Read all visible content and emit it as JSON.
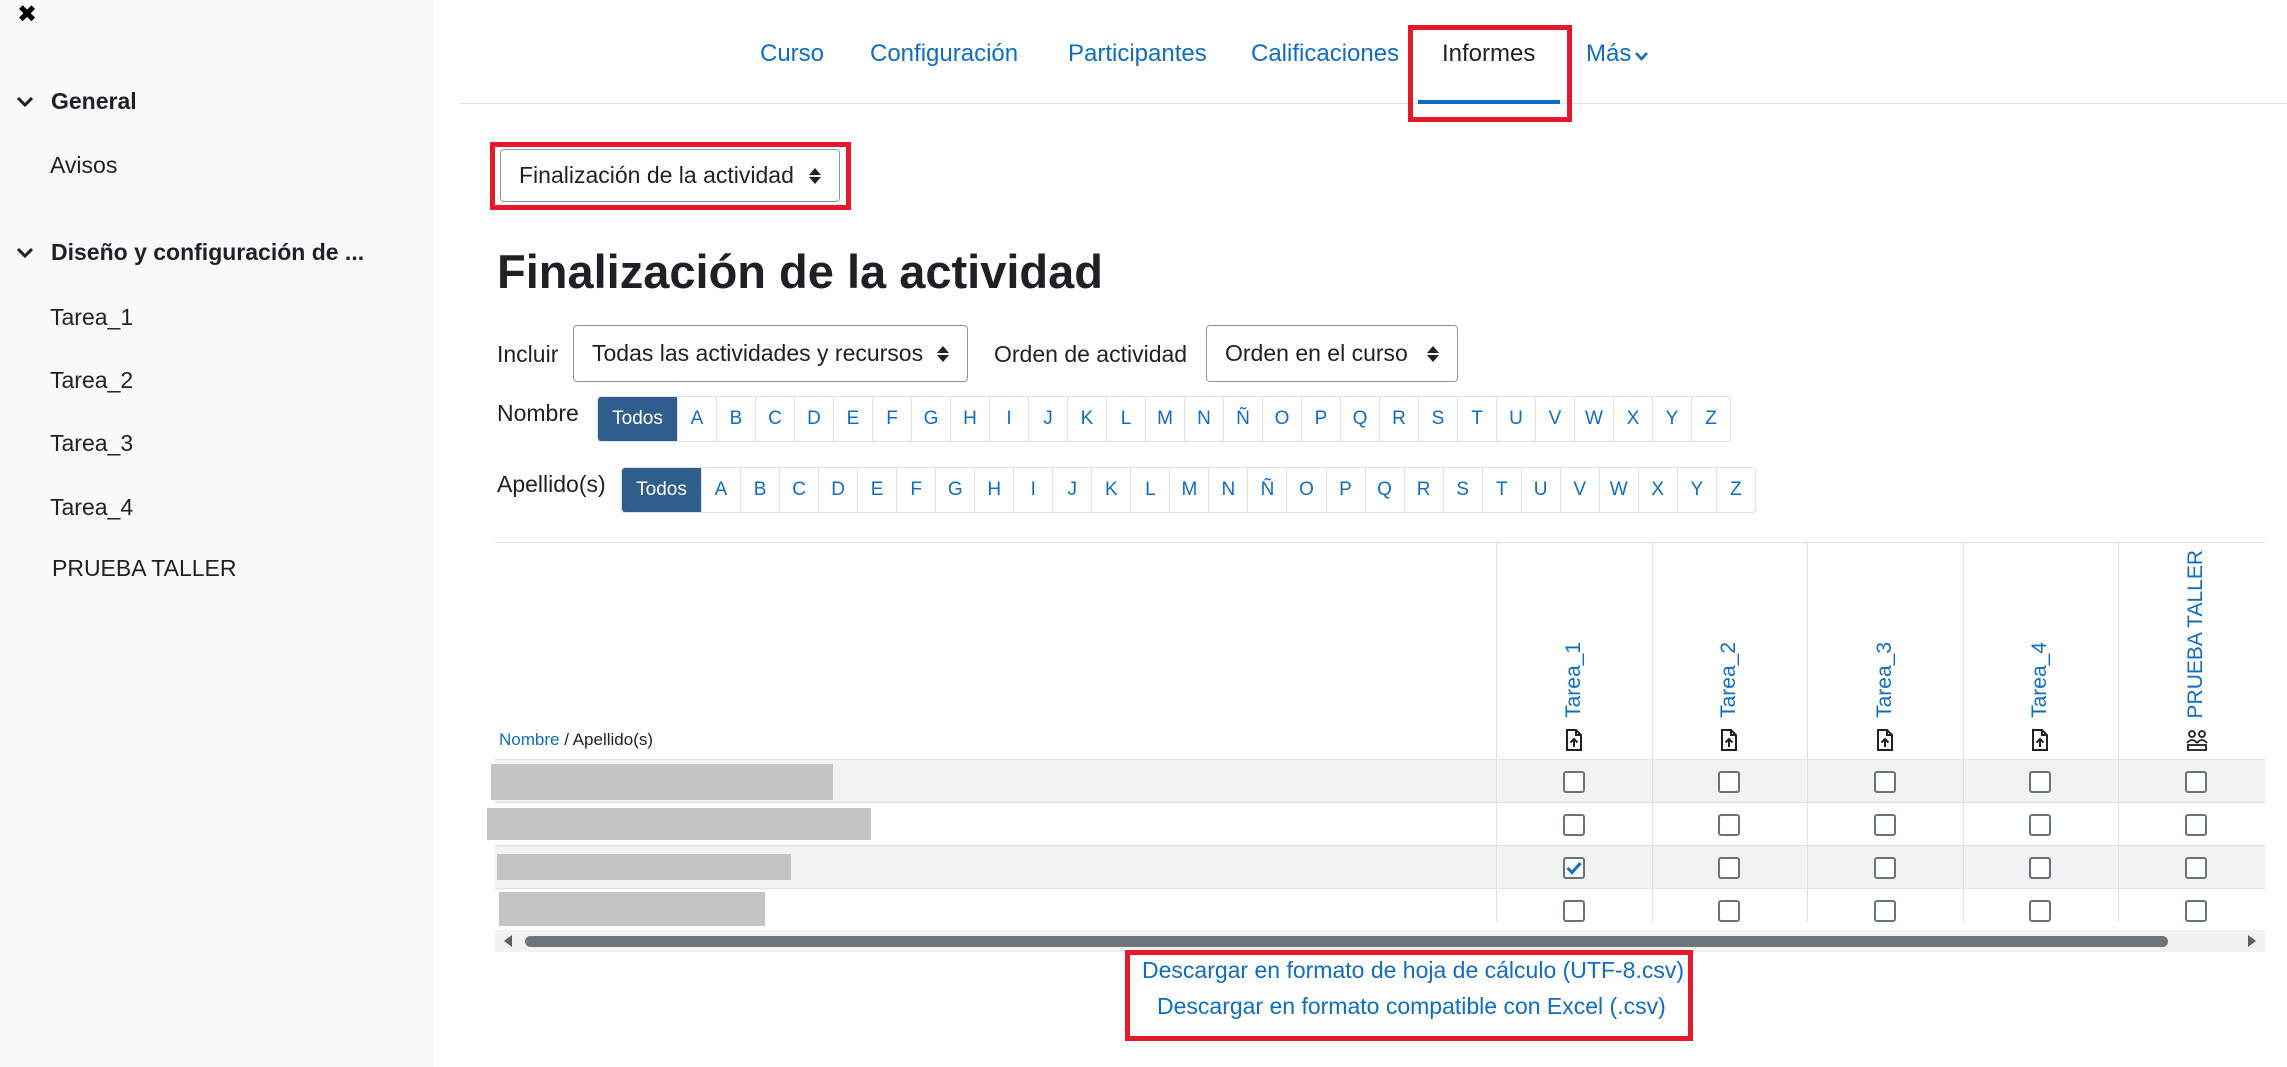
{
  "sidebar": {
    "close_glyph": "✖",
    "sections": [
      {
        "label": "General",
        "items": [
          "Avisos"
        ]
      },
      {
        "label": "Diseño y configuración de ...",
        "items": [
          "Tarea_1",
          "Tarea_2",
          "Tarea_3",
          "Tarea_4",
          "PRUEBA TALLER"
        ]
      }
    ]
  },
  "nav": {
    "tabs": [
      "Curso",
      "Configuración",
      "Participantes",
      "Calificaciones",
      "Informes"
    ],
    "active_tab": "Informes",
    "more_label": "Más"
  },
  "report_select": {
    "value": "Finalización de la actividad"
  },
  "page_title": "Finalización de la actividad",
  "filters": {
    "include_label": "Incluir",
    "include_value": "Todas las actividades y recursos",
    "order_label": "Orden de actividad",
    "order_value": "Orden en el curso"
  },
  "firstname_filter": {
    "label": "Nombre",
    "all": "Todos",
    "letters": [
      "A",
      "B",
      "C",
      "D",
      "E",
      "F",
      "G",
      "H",
      "I",
      "J",
      "K",
      "L",
      "M",
      "N",
      "Ñ",
      "O",
      "P",
      "Q",
      "R",
      "S",
      "T",
      "U",
      "V",
      "W",
      "X",
      "Y",
      "Z"
    ]
  },
  "lastname_filter": {
    "label": "Apellido(s)",
    "all": "Todos"
  },
  "table": {
    "name_header_link": "Nombre",
    "name_header_sep": " / ",
    "name_header_rest": "Apellido(s)",
    "activities": [
      "Tarea_1",
      "Tarea_2",
      "Tarea_3",
      "Tarea_4",
      "PRUEBA TALLER"
    ],
    "rows": [
      [
        false,
        false,
        false,
        false,
        false
      ],
      [
        false,
        false,
        false,
        false,
        false
      ],
      [
        true,
        false,
        false,
        false,
        false
      ],
      [
        false,
        false,
        false,
        false,
        false
      ]
    ]
  },
  "downloads": {
    "spreadsheet": "Descargar en formato de hoja de cálculo (UTF-8.csv)",
    "excel": "Descargar en formato compatible con Excel (.csv)"
  },
  "colors": {
    "accent": "#0f6cbf",
    "highlight": "#e6192b",
    "active_letter_bg": "#2f5e8d",
    "checked": "#0f6cbf"
  }
}
